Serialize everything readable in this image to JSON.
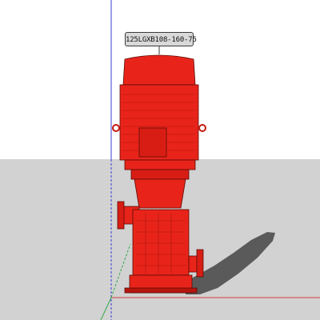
{
  "model_label": {
    "text": "125LGXB108-160-75"
  },
  "colors": {
    "sky": "#ffffff",
    "ground": "#d2d2d2",
    "pump_red": "#e8241a",
    "pump_red_light": "#ff3b2d",
    "pump_red_dark": "#b5160e",
    "outline": "#5a0c08",
    "shadow": "#5a5a5a",
    "axis_blue": "#3b3bd8",
    "axis_green": "#2fa84a",
    "axis_red": "#d23c3c",
    "tag_fill": "#d9d9d9"
  },
  "icons": {
    "axis_indicator": "axes-icon",
    "lifting_eye": "ring-icon"
  }
}
